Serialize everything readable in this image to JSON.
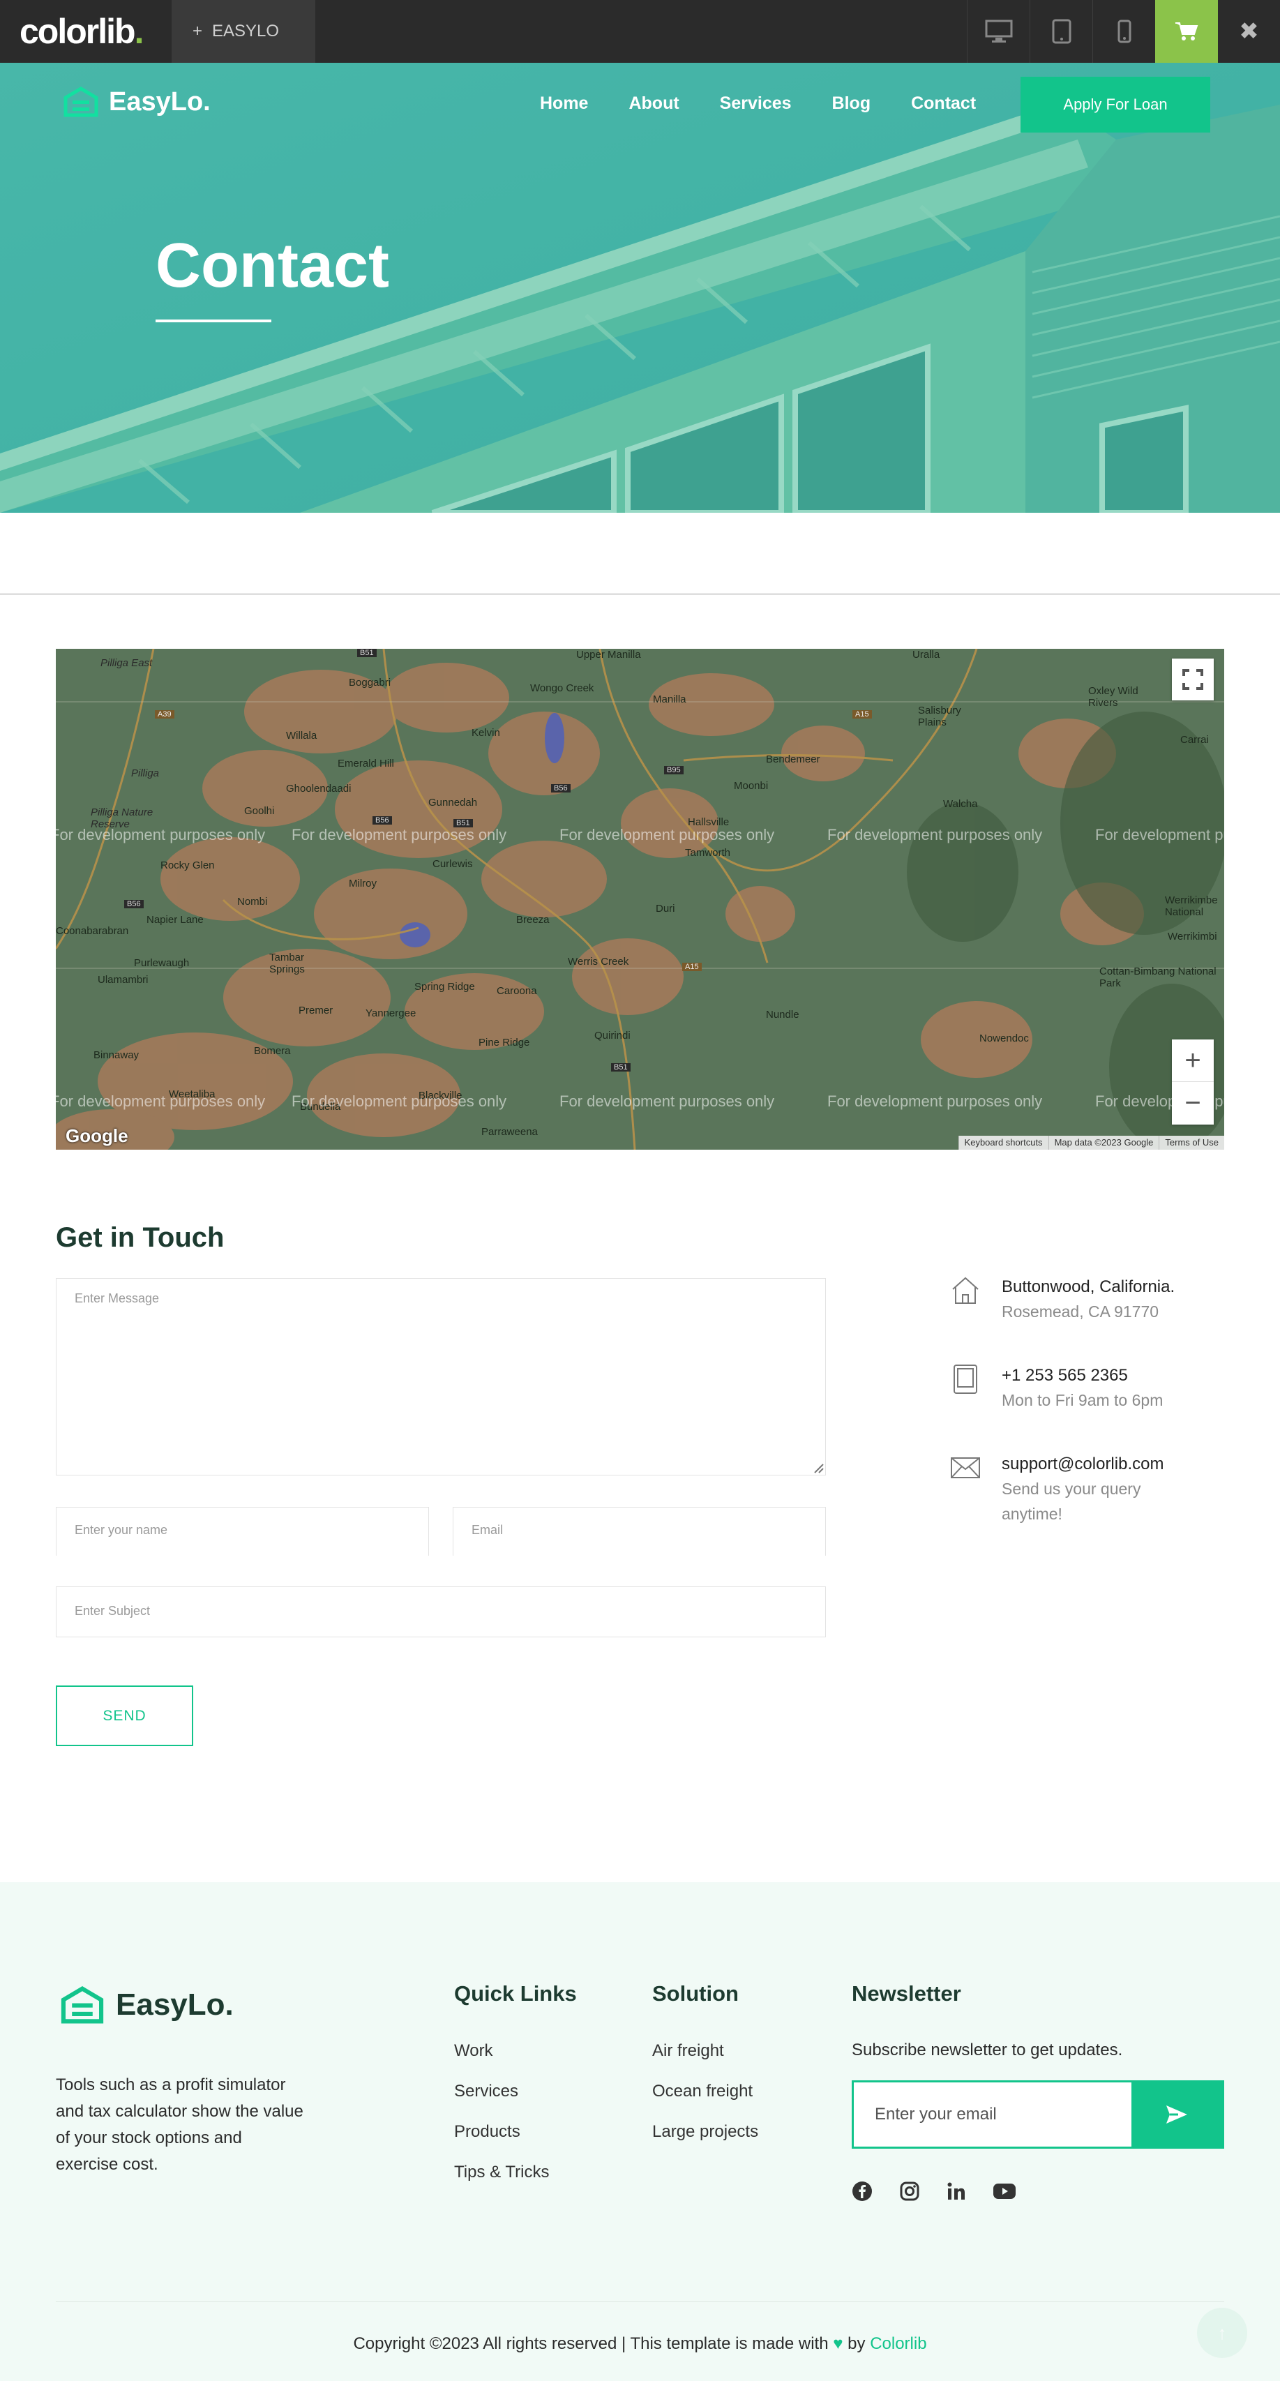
{
  "preview_bar": {
    "logo_text": "colorlib",
    "logo_dot": ".",
    "project_tab_prefix": "+",
    "project_tab_label": "EASYLO",
    "devices": [
      "desktop-icon",
      "tablet-icon",
      "mobile-icon"
    ],
    "cart_icon": "cart-icon",
    "close_label": "✖"
  },
  "header": {
    "brand": "EasyLo.",
    "nav": [
      "Home",
      "About",
      "Services",
      "Blog",
      "Contact"
    ],
    "cta_label": "Apply For Loan"
  },
  "hero": {
    "title": "Contact"
  },
  "map": {
    "watermark": "For development purposes only",
    "google_label": "Google",
    "attribution": [
      "Keyboard shortcuts",
      "Map data ©2023 Google",
      "Terms of Use"
    ],
    "zoom_in_label": "+",
    "zoom_out_label": "−",
    "places": [
      {
        "name": "Pilliga East",
        "style": "it"
      },
      {
        "name": "Boggabri",
        "style": ""
      },
      {
        "name": "Upper Manilla",
        "style": ""
      },
      {
        "name": "Uralla",
        "style": ""
      },
      {
        "name": "Wongo Creek",
        "style": ""
      },
      {
        "name": "Manilla",
        "style": ""
      },
      {
        "name": "Oxley Wild Rivers",
        "style": ""
      },
      {
        "name": "Salisbury Plains",
        "style": ""
      },
      {
        "name": "Carrai",
        "style": ""
      },
      {
        "name": "Willala",
        "style": ""
      },
      {
        "name": "Kelvin",
        "style": ""
      },
      {
        "name": "Emerald Hill",
        "style": ""
      },
      {
        "name": "Bendemeer",
        "style": ""
      },
      {
        "name": "Pilliga",
        "style": "it"
      },
      {
        "name": "Ghoolendaadi",
        "style": ""
      },
      {
        "name": "Moonbi",
        "style": ""
      },
      {
        "name": "Gunnedah",
        "style": ""
      },
      {
        "name": "Goolhi",
        "style": ""
      },
      {
        "name": "Walcha",
        "style": ""
      },
      {
        "name": "Pilliga Nature Reserve",
        "style": "it"
      },
      {
        "name": "Hallsville",
        "style": ""
      },
      {
        "name": "Curlewis",
        "style": ""
      },
      {
        "name": "Tamworth",
        "style": ""
      },
      {
        "name": "Rocky Glen",
        "style": ""
      },
      {
        "name": "Milroy",
        "style": ""
      },
      {
        "name": "Nombi",
        "style": ""
      },
      {
        "name": "Duri",
        "style": ""
      },
      {
        "name": "Napier Lane",
        "style": ""
      },
      {
        "name": "Breeza",
        "style": ""
      },
      {
        "name": "Werrikimbe National",
        "style": ""
      },
      {
        "name": "Coonabarabran",
        "style": ""
      },
      {
        "name": "Purlewaugh",
        "style": ""
      },
      {
        "name": "Tambar Springs",
        "style": ""
      },
      {
        "name": "Werris Creek",
        "style": ""
      },
      {
        "name": "Ulamambri",
        "style": ""
      },
      {
        "name": "Cottan-Bimbang National Park",
        "style": ""
      },
      {
        "name": "Spring Ridge",
        "style": ""
      },
      {
        "name": "Caroona",
        "style": ""
      },
      {
        "name": "Premer",
        "style": ""
      },
      {
        "name": "Yannergee",
        "style": ""
      },
      {
        "name": "Nundle",
        "style": ""
      },
      {
        "name": "Quirindi",
        "style": ""
      },
      {
        "name": "Pine Ridge",
        "style": ""
      },
      {
        "name": "Nowendoc",
        "style": ""
      },
      {
        "name": "Binnaway",
        "style": ""
      },
      {
        "name": "Bomera",
        "style": ""
      },
      {
        "name": "Weetaliba",
        "style": ""
      },
      {
        "name": "Bundella",
        "style": ""
      },
      {
        "name": "Blackville",
        "style": ""
      },
      {
        "name": "Parraweena",
        "style": ""
      },
      {
        "name": "Werrikimbi",
        "style": ""
      }
    ],
    "road_labels": [
      "B51",
      "A39",
      "A15",
      "B56",
      "B95",
      "B56",
      "B51",
      "B56",
      "A15",
      "B51"
    ]
  },
  "contact_form": {
    "title": "Get in Touch",
    "message_placeholder": "Enter Message",
    "name_placeholder": "Enter your name",
    "email_placeholder": "Email",
    "subject_placeholder": "Enter Subject",
    "send_label": "SEND"
  },
  "contact_info": [
    {
      "icon": "home-icon",
      "line1": "Buttonwood, California.",
      "line2": "Rosemead, CA 91770"
    },
    {
      "icon": "tablet-icon",
      "line1": "+1 253 565 2365",
      "line2": "Mon to Fri 9am to 6pm"
    },
    {
      "icon": "mail-icon",
      "line1": "support@colorlib.com",
      "line2a": "Send us your query",
      "line2b": "anytime!"
    }
  ],
  "footer": {
    "brand": "EasyLo.",
    "description_lines": [
      "Tools such as a profit simulator",
      "and tax calculator show the value",
      "of your stock options and",
      "exercise cost."
    ],
    "quick_links_title": "Quick Links",
    "quick_links": [
      "Work",
      "Services",
      "Products",
      "Tips & Tricks"
    ],
    "solution_title": "Solution",
    "solution_links": [
      "Air freight",
      "Ocean freight",
      "Large projects"
    ],
    "newsletter_title": "Newsletter",
    "newsletter_text": "Subscribe newsletter to get updates.",
    "newsletter_placeholder": "Enter your email",
    "socials": [
      "facebook-icon",
      "instagram-icon",
      "linkedin-icon",
      "youtube-icon"
    ],
    "copyright_prefix": "Copyright ©2023 All rights reserved | This template is made with",
    "copyright_by": "by",
    "copyright_link": "Colorlib",
    "to_top_label": "↑"
  },
  "colors": {
    "accent": "#12c48b",
    "hero_teal": "#47b8ab",
    "preview_green": "#8bc34a",
    "heading_dark": "#1d3b30",
    "footer_bg": "#f1faf6"
  }
}
